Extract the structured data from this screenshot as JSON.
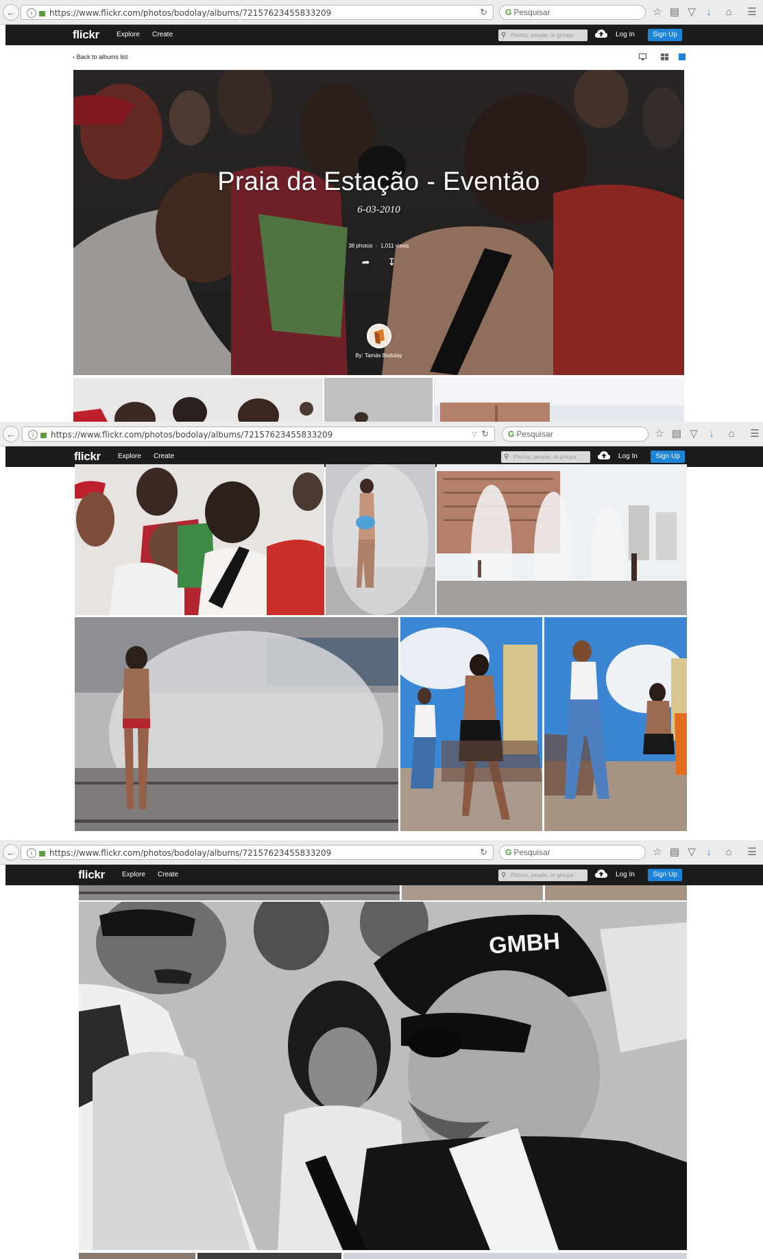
{
  "browser": {
    "url": "https://www.flickr.com/photos/bodolay/albums/72157623455833209",
    "search_placeholder": "Pesquisar"
  },
  "nav": {
    "logo": "flickr",
    "explore": "Explore",
    "create": "Create",
    "search_placeholder": "Photos, people, or groups",
    "login": "Log In",
    "signup": "Sign Up"
  },
  "album": {
    "back_link": "Back to albums list",
    "title": "Praia da Estação - Eventão",
    "date": "6-03-2010",
    "photo_count": "38 photos",
    "views": "1,011 views",
    "author": "By: Tamás Bodolay"
  },
  "photos": [
    {
      "id": "crowd-color",
      "subject": "crowd of young people at festival"
    },
    {
      "id": "man-fountain",
      "subject": "shirtless man playing in fountain spray"
    },
    {
      "id": "fountains-buildings",
      "subject": "water jets with tall buildings behind"
    },
    {
      "id": "boy-fountain",
      "subject": "boy standing in fountain water"
    },
    {
      "id": "dancers-1",
      "subject": "people dancing in square"
    },
    {
      "id": "dancers-2",
      "subject": "woman dancing in jeans"
    },
    {
      "id": "bw-guard",
      "subject": "black and white guard in GMBH cap with crowd"
    }
  ],
  "photo_text": {
    "cap": "GMBH"
  },
  "colors": {
    "flickr_bar": "#1c1c1c",
    "signup_blue": "#1c83d7",
    "active_view": "#1c83d7"
  }
}
